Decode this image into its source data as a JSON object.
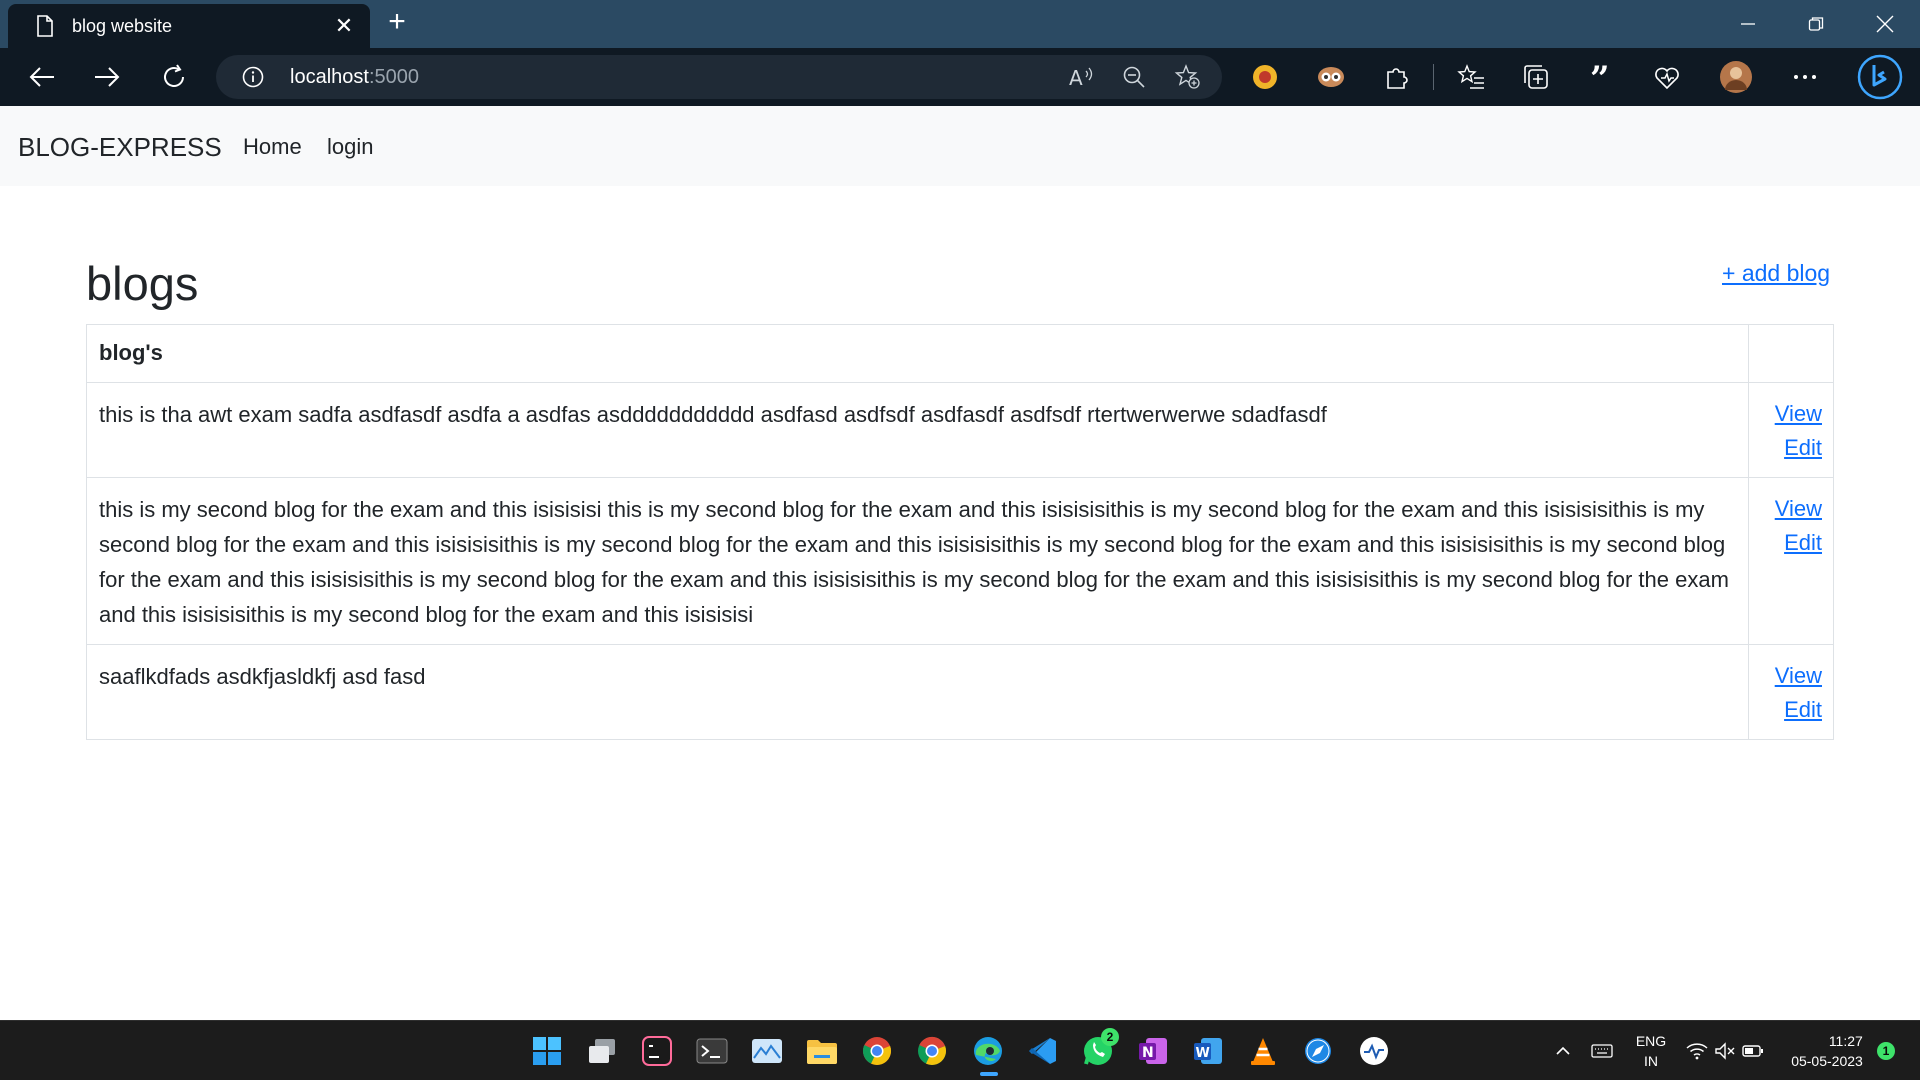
{
  "browser": {
    "tab_title": "blog website",
    "url_host": "localhost",
    "url_port": ":5000"
  },
  "navbar": {
    "brand": "BLOG-EXPRESS",
    "links": [
      "Home",
      "login"
    ]
  },
  "main": {
    "title": "blogs",
    "add_link": "+ add blog",
    "table": {
      "header": "blog's",
      "rows": [
        {
          "text": "this is tha awt exam sadfa asdfasdf asdfa a asdfas asddddddddddd asdfasd asdfsdf asdfasdf asdfsdf rtertwerwerwe sdadfasdf",
          "view": "View",
          "edit": "Edit"
        },
        {
          "text": "this is my second blog for the exam and this isisisisi this is my second blog for the exam and this isisisisithis is my second blog for the exam and this isisisisithis is my second blog for the exam and this isisisisithis is my second blog for the exam and this isisisisithis is my second blog for the exam and this isisisisithis is my second blog for the exam and this isisisisithis is my second blog for the exam and this isisisisithis is my second blog for the exam and this isisisisithis is my second blog for the exam and this isisisisithis is my second blog for the exam and this isisisisi",
          "view": "View",
          "edit": "Edit"
        },
        {
          "text": "saaflkdfads asdkfjasldkfj asd fasd",
          "view": "View",
          "edit": "Edit"
        }
      ]
    }
  },
  "taskbar": {
    "whatsapp_badge": "2",
    "lang_top": "ENG",
    "lang_bottom": "IN",
    "time": "11:27",
    "date": "05-05-2023",
    "notification_count": "1"
  },
  "colors": {
    "link": "#0d6efd",
    "navbar_bg": "#f8f9fa",
    "titlebar_bg": "#2b4a63",
    "toolbar_bg": "#0f1923"
  }
}
